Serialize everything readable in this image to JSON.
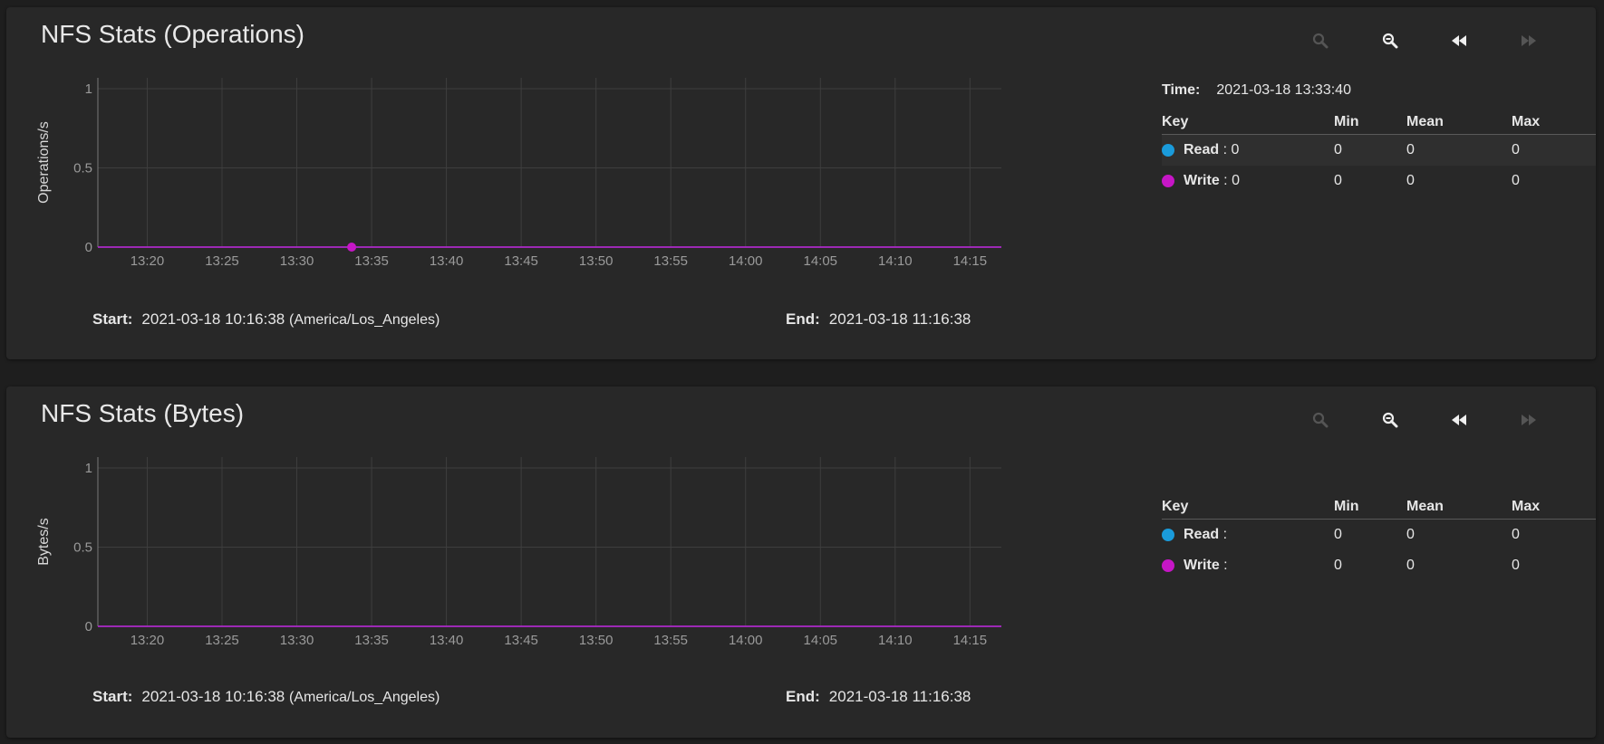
{
  "colors": {
    "read": "#1a9bdb",
    "write": "#c616c6",
    "grid": "#3e3e3e",
    "axis": "#9a9a9a"
  },
  "icons": {
    "zoom_in": "zoom-in-icon",
    "zoom_out": "zoom-out-icon",
    "back": "rewind-icon",
    "forward": "fast-forward-icon"
  },
  "cards": [
    {
      "title": "NFS Stats (Operations)",
      "time_label": "Time:",
      "time_value": "2021-03-18 13:33:40",
      "start_label": "Start:",
      "start_value": "2021-03-18 10:16:38",
      "start_tz": "(America/Los_Angeles)",
      "end_label": "End:",
      "end_value": "2021-03-18 11:16:38",
      "legend": {
        "headers": [
          "Key",
          "Min",
          "Mean",
          "Max"
        ],
        "rows": [
          {
            "name": "Read",
            "current": ": 0",
            "min": "0",
            "mean": "0",
            "max": "0"
          },
          {
            "name": "Write",
            "current": ": 0",
            "min": "0",
            "mean": "0",
            "max": "0"
          }
        ]
      },
      "chart_data": {
        "type": "line",
        "ylabel": "Operations/s",
        "ylim": [
          0,
          1
        ],
        "y_ticks": [
          "1",
          "0.5",
          "0"
        ],
        "x_ticks": [
          "13:20",
          "13:25",
          "13:30",
          "13:35",
          "13:40",
          "13:45",
          "13:50",
          "13:55",
          "14:00",
          "14:05",
          "14:10",
          "14:15"
        ],
        "x_range_minutes": [
          796.7,
          857.1
        ],
        "series": [
          {
            "name": "Read",
            "values": [
              0,
              0
            ]
          },
          {
            "name": "Write",
            "values": [
              0,
              0
            ]
          }
        ],
        "highlight": {
          "series": "Write",
          "x": "13:33:40",
          "y": 0
        }
      }
    },
    {
      "title": "NFS Stats (Bytes)",
      "start_label": "Start:",
      "start_value": "2021-03-18 10:16:38",
      "start_tz": "(America/Los_Angeles)",
      "end_label": "End:",
      "end_value": "2021-03-18 11:16:38",
      "legend": {
        "headers": [
          "Key",
          "Min",
          "Mean",
          "Max"
        ],
        "rows": [
          {
            "name": "Read",
            "current": ":",
            "min": "0",
            "mean": "0",
            "max": "0"
          },
          {
            "name": "Write",
            "current": ":",
            "min": "0",
            "mean": "0",
            "max": "0"
          }
        ]
      },
      "chart_data": {
        "type": "line",
        "ylabel": "Bytes/s",
        "ylim": [
          0,
          1
        ],
        "y_ticks": [
          "1",
          "0.5",
          "0"
        ],
        "x_ticks": [
          "13:20",
          "13:25",
          "13:30",
          "13:35",
          "13:40",
          "13:45",
          "13:50",
          "13:55",
          "14:00",
          "14:05",
          "14:10",
          "14:15"
        ],
        "x_range_minutes": [
          796.7,
          857.1
        ],
        "series": [
          {
            "name": "Read",
            "values": [
              0,
              0
            ]
          },
          {
            "name": "Write",
            "values": [
              0,
              0
            ]
          }
        ]
      }
    }
  ]
}
